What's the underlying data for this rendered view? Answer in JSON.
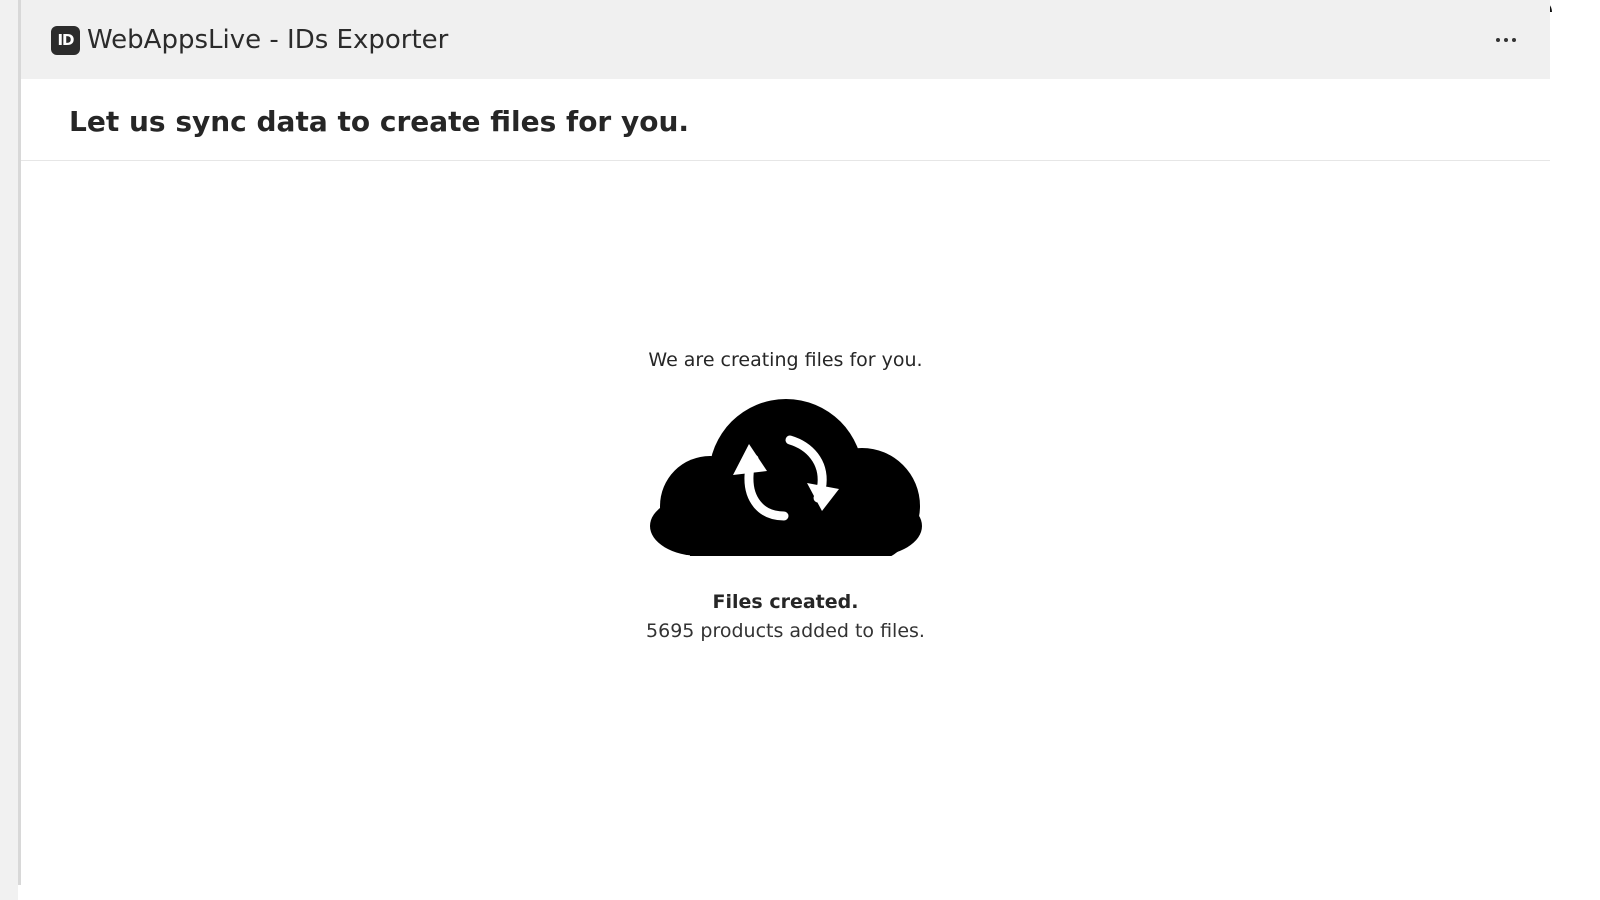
{
  "app": {
    "logo_text": "ID",
    "title": "WebAppsLive - IDs Exporter",
    "more_icon": "more-horizontal-icon"
  },
  "header": {
    "heading": "Let us sync data to create files for you."
  },
  "status": {
    "intro": "We are creating files for you.",
    "icon": "cloud-sync-icon",
    "title": "Files created.",
    "detail": "5695 products added to files."
  },
  "colors": {
    "titlebar_bg": "#f0f0f0",
    "text": "#262626",
    "icon": "#000000"
  }
}
